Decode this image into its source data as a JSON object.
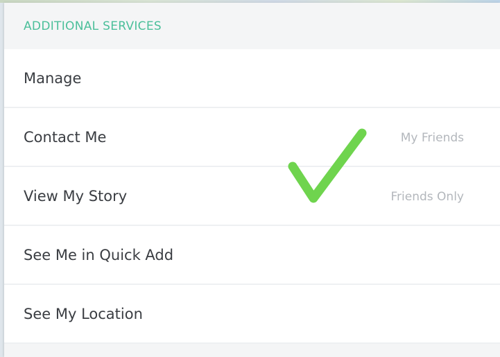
{
  "section": {
    "title": "ADDITIONAL SERVICES"
  },
  "rows": [
    {
      "label": "Manage",
      "value": ""
    },
    {
      "label": "Contact Me",
      "value": "My Friends"
    },
    {
      "label": "View My Story",
      "value": "Friends Only"
    },
    {
      "label": "See Me in Quick Add",
      "value": ""
    },
    {
      "label": "See My Location",
      "value": ""
    }
  ],
  "colors": {
    "accent": "#4bbf9a",
    "checkmark": "#6fd44e"
  },
  "overlay": {
    "icon": "checkmark-icon"
  }
}
